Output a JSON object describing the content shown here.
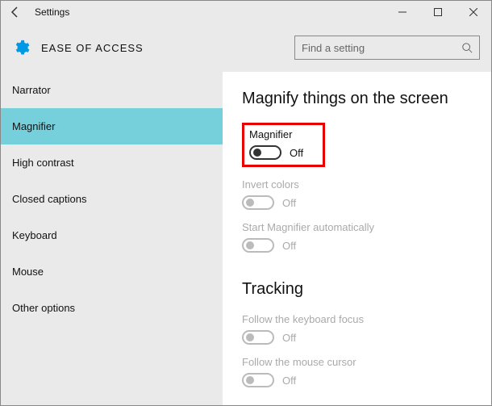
{
  "window": {
    "title": "Settings"
  },
  "header": {
    "title": "EASE OF ACCESS"
  },
  "search": {
    "placeholder": "Find a setting"
  },
  "sidebar": {
    "items": [
      {
        "label": "Narrator"
      },
      {
        "label": "Magnifier"
      },
      {
        "label": "High contrast"
      },
      {
        "label": "Closed captions"
      },
      {
        "label": "Keyboard"
      },
      {
        "label": "Mouse"
      },
      {
        "label": "Other options"
      }
    ]
  },
  "main": {
    "section1_title": "Magnify things on the screen",
    "section2_title": "Tracking",
    "settings": {
      "magnifier": {
        "label": "Magnifier",
        "state": "Off"
      },
      "invert": {
        "label": "Invert colors",
        "state": "Off"
      },
      "autostart": {
        "label": "Start Magnifier automatically",
        "state": "Off"
      },
      "keyboard_focus": {
        "label": "Follow the keyboard focus",
        "state": "Off"
      },
      "mouse_cursor": {
        "label": "Follow the mouse cursor",
        "state": "Off"
      }
    }
  }
}
